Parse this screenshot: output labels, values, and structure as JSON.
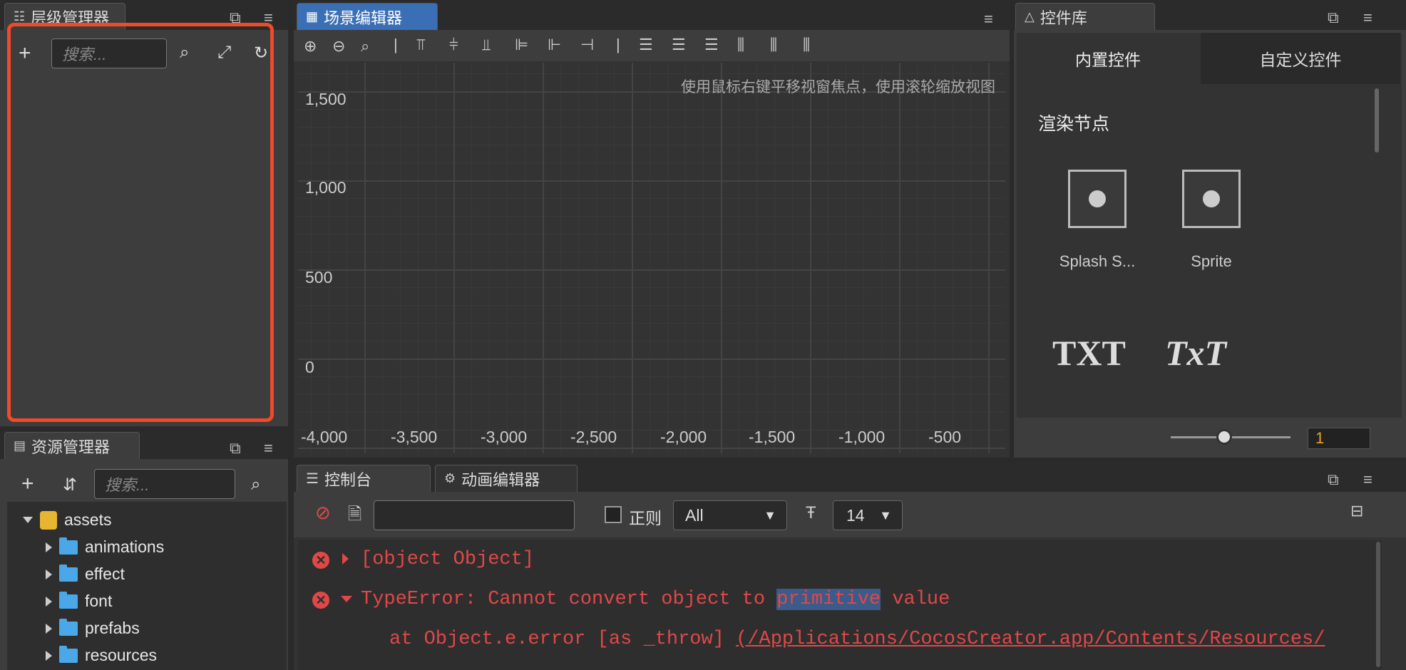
{
  "hierarchy": {
    "title": "层级管理器",
    "search_placeholder": "搜索..."
  },
  "assets": {
    "title": "资源管理器",
    "search_placeholder": "搜索...",
    "root": "assets",
    "items": [
      "animations",
      "effect",
      "font",
      "prefabs",
      "resources"
    ]
  },
  "scene": {
    "title": "场景编辑器",
    "hint": "使用鼠标右键平移视窗焦点，使用滚轮缩放视图",
    "y_ticks": [
      "1,500",
      "1,000",
      "500",
      "0"
    ],
    "x_ticks": [
      "-4,000",
      "-3,500",
      "-3,000",
      "-2,500",
      "-2,000",
      "-1,500",
      "-1,000",
      "-500"
    ]
  },
  "library": {
    "title": "控件库",
    "tab_builtin": "内置控件",
    "tab_custom": "自定义控件",
    "section": "渲染节点",
    "items": [
      "Splash S...",
      "Sprite"
    ],
    "text_items": [
      "TXT",
      "TxT"
    ],
    "zoom_value": "1"
  },
  "console": {
    "tab_console": "控制台",
    "tab_anim": "动画编辑器",
    "regex_label": "正则",
    "filter_value": "All",
    "font_size": "14",
    "line1": "[object Object]",
    "line2_prefix": "TypeError: Cannot convert object to ",
    "line2_highlight": "primitive",
    "line2_suffix": " value",
    "line3_prefix": "at Object.e.error [as _throw]  ",
    "line3_link": "(/Applications/CocosCreator.app/Contents/Resources/"
  },
  "colors": {
    "accent": "#3b6fb5",
    "error": "#e04848",
    "highlight_box": "#f04a2a"
  }
}
